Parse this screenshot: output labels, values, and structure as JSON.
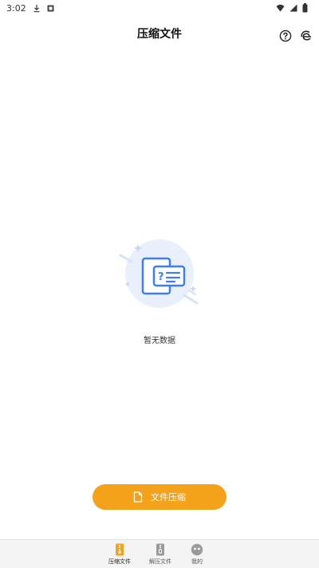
{
  "status_bar": {
    "time": "3:02"
  },
  "header": {
    "title": "压缩文件"
  },
  "empty_state": {
    "message": "暂无数据"
  },
  "action": {
    "compress_label": "文件压缩"
  },
  "bottom_nav": {
    "items": [
      {
        "label": "压缩文件",
        "icon": "zip-file-icon",
        "active": true
      },
      {
        "label": "解压文件",
        "icon": "unzip-file-icon",
        "active": false
      },
      {
        "label": "我的",
        "icon": "profile-face-icon",
        "active": false
      }
    ]
  },
  "colors": {
    "accent": "#f5a21b",
    "illustration_blue": "#3d7ef2",
    "illustration_bg": "#e9f0fc"
  }
}
